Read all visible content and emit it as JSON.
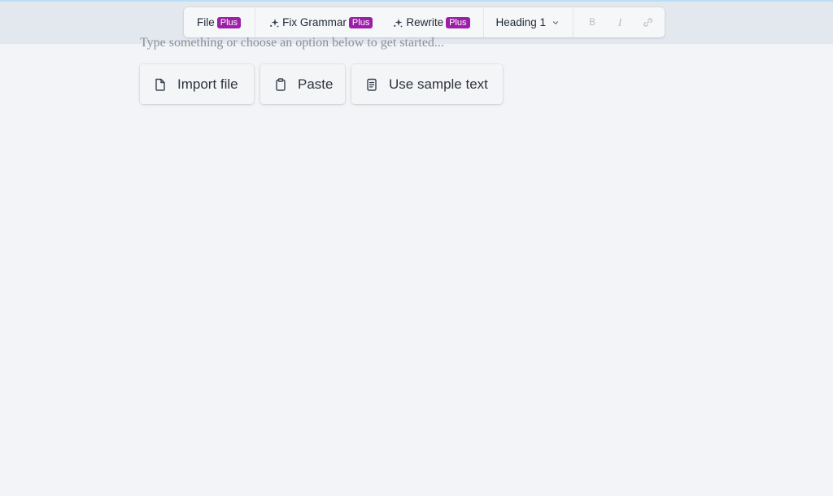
{
  "toolbar": {
    "file_label": "File",
    "file_badge": "Plus",
    "fix_grammar_label": "Fix Grammar",
    "fix_grammar_badge": "Plus",
    "rewrite_label": "Rewrite",
    "rewrite_badge": "Plus",
    "heading_label": "Heading 1",
    "bold_label": "B",
    "italic_label": "I",
    "link_icon": "link-icon"
  },
  "editor": {
    "placeholder": "Type something or choose an option below to get started..."
  },
  "actions": [
    {
      "label": "Import file",
      "icon": "file-icon"
    },
    {
      "label": "Paste",
      "icon": "clipboard-icon"
    },
    {
      "label": "Use sample text",
      "icon": "document-text-icon"
    }
  ],
  "colors": {
    "badge": "#9c1fa8",
    "background": "#f2f4f7",
    "topbar": "#e3e7ee",
    "accent_line": "#b9dff5"
  }
}
